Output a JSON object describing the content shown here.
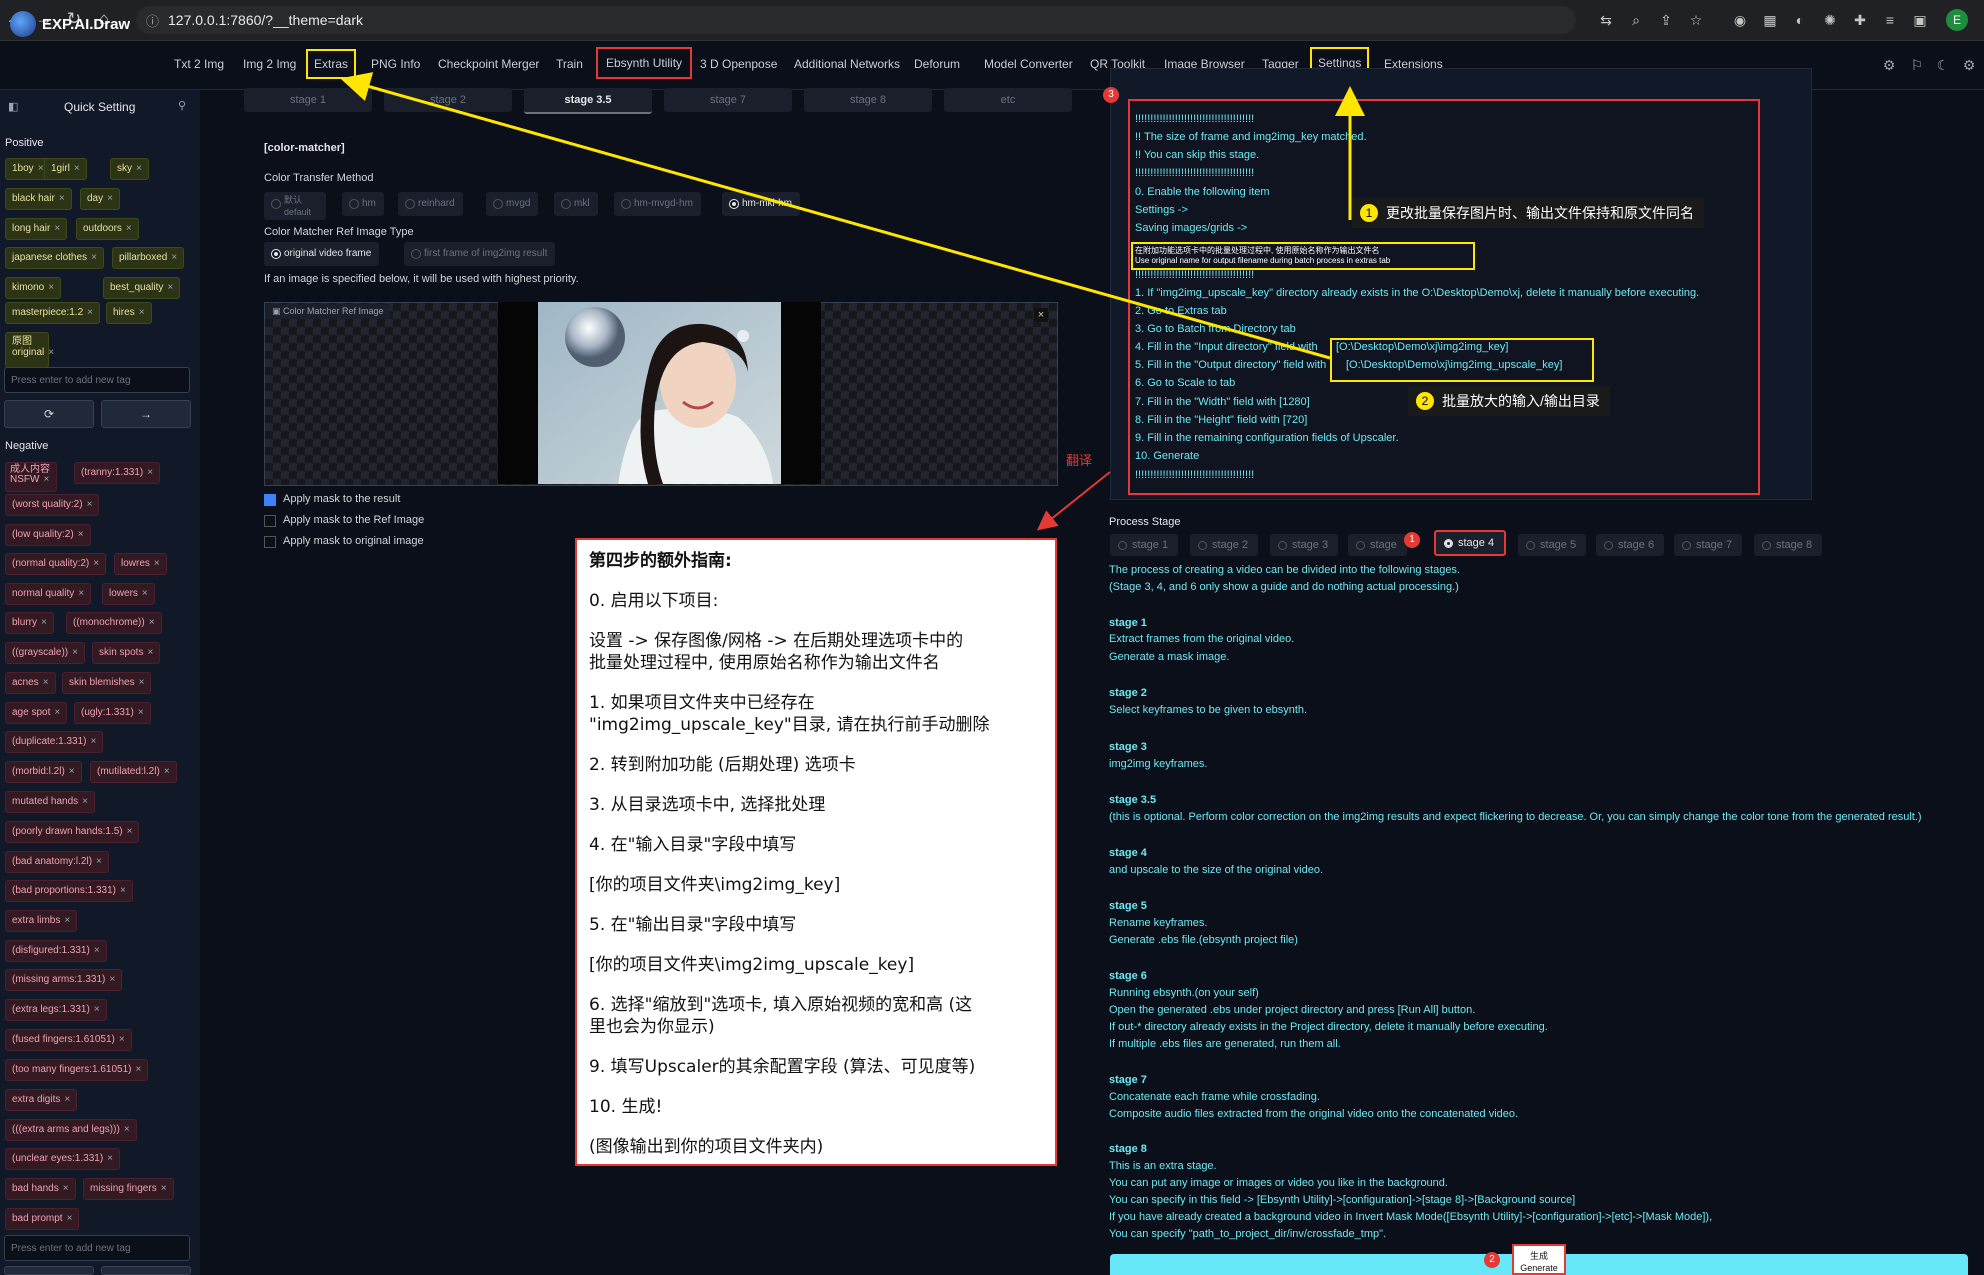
{
  "browser": {
    "url": "127.0.0.1:7860/?__theme=dark",
    "profile_initial": "E"
  },
  "app": {
    "name": "EXP.AI.Draw",
    "tabs": [
      "Txt 2 Img",
      "Img 2 Img",
      "Extras",
      "PNG Info",
      "Checkpoint Merger",
      "Train",
      "Ebsynth Utility",
      "3 D Openpose",
      "Additional Networks",
      "Deforum",
      "Model Converter",
      "QR Toolkit",
      "Image Browser",
      "Tagger",
      "Settings",
      "Extensions"
    ]
  },
  "left": {
    "title": "Quick Setting",
    "positive_label": "Positive",
    "positive_tags": [
      "1boy",
      "1girl",
      "sky",
      "black hair",
      "day",
      "long hair",
      "outdoors",
      "japanese clothes",
      "pillarboxed",
      "kimono",
      "best_quality",
      "masterpiece:1.2",
      "hires",
      "原图 original"
    ],
    "tag_placeholder": "Press enter to add new tag",
    "negative_label": "Negative",
    "negative_tags": [
      "成人内容 NSFW",
      "(tranny:1.331)",
      "(worst quality:2)",
      "(low quality:2)",
      "(normal quality:2)",
      "lowres",
      "normal quality",
      "lowers",
      "blurry",
      "((monochrome))",
      "((grayscale))",
      "skin spots",
      "acnes",
      "skin blemishes",
      "age spot",
      "(ugly:1.331)",
      "(duplicate:1.331)",
      "(morbid:l.2l)",
      "(mutilated:l.2l)",
      "mutated hands",
      "(poorly drawn hands:1.5)",
      "(bad anatomy:l.2l)",
      "(bad proportions:1.331)",
      "extra limbs",
      "(disfigured:1.331)",
      "(missing arms:1.331)",
      "(extra legs:1.331)",
      "(fused fingers:1.61051)",
      "(too many fingers:1.61051)",
      "extra digits",
      "(((extra arms and legs)))",
      "(unclear eyes:1.331)",
      "bad hands",
      "missing fingers",
      "bad prompt"
    ]
  },
  "mid": {
    "stage_tabs": [
      "stage 1",
      "stage 2",
      "stage 3.5",
      "stage 7",
      "stage 8",
      "etc"
    ],
    "section_title": "[color-matcher]",
    "transfer_label": "Color Transfer Method",
    "transfer_options": [
      "默认 default",
      "hm",
      "reinhard",
      "mvgd",
      "mkl",
      "hm-mvgd-hm",
      "hm-mkl-hm"
    ],
    "ref_type_label": "Color Matcher Ref Image Type",
    "ref_type_options": [
      "original video frame",
      "first frame of img2img result"
    ],
    "priority_note": "If an image is specified below, it will be used with highest priority.",
    "image_label": "Color Matcher Ref Image",
    "checkboxes": [
      "Apply mask to the result",
      "Apply mask to the Ref Image",
      "Apply mask to original image"
    ],
    "translate_label": "翻译"
  },
  "guide": {
    "title": "第四步的额外指南:",
    "lines": [
      "0. 启用以下项目:",
      "设置 -> 保存图像/网格 -> 在后期处理选项卡中的",
      "批量处理过程中, 使用原始名称作为输出文件名",
      "1. 如果项目文件夹中已经存在",
      "\"img2img_upscale_key\"目录, 请在执行前手动删除",
      "2. 转到附加功能 (后期处理) 选项卡",
      "3. 从目录选项卡中, 选择批处理",
      "4. 在\"输入目录\"字段中填写",
      "[你的项目文件夹\\img2img_key]",
      "5. 在\"输出目录\"字段中填写",
      "[你的项目文件夹\\img2img_upscale_key]",
      "6. 选择\"缩放到\"选项卡, 填入原始视频的宽和高 (这",
      "里也会为你显示)",
      "9. 填写Upscaler的其余配置字段 (算法、可见度等)",
      "10. 生成!",
      "(图像输出到你的项目文件夹内)"
    ]
  },
  "log": {
    "badge": "3",
    "lines": [
      "!!!!!!!!!!!!!!!!!!!!!!!!!!!!!!!!!!!!!!!",
      "!! The size of frame and img2img_key matched.",
      "!! You can skip this stage.",
      "!!!!!!!!!!!!!!!!!!!!!!!!!!!!!!!!!!!!!!!",
      "0. Enable the following item",
      "Settings ->",
      "Saving images/grids ->",
      "在附加功能选项卡中的批量处理过程中, 使用原始名称作为输出文件名",
      "Use original name for output filename during batch process in extras tab",
      "!!!!!!!!!!!!!!!!!!!!!!!!!!!!!!!!!!!!!!!",
      "1. If \"img2img_upscale_key\" directory already exists in the O:\\Desktop\\Demo\\xj, delete it manually before executing.",
      "2. Go to Extras tab",
      "3. Go to Batch from Directory tab",
      "4. Fill in the \"Input directory\" field with",
      "[O:\\Desktop\\Demo\\xj\\img2img_key]",
      "5. Fill in the \"Output directory\" field with",
      "[O:\\Desktop\\Demo\\xj\\img2img_upscale_key]",
      "6. Go to Scale to tab",
      "7. Fill in the \"Width\" field with [1280]",
      "8. Fill in the \"Height\" field with [720]",
      "9. Fill in the remaining configuration fields of Upscaler.",
      "10. Generate",
      "!!!!!!!!!!!!!!!!!!!!!!!!!!!!!!!!!!!!!!!"
    ]
  },
  "callouts": [
    {
      "num": "1",
      "text": "更改批量保存图片时、输出文件保持和原文件同名"
    },
    {
      "num": "2",
      "text": "批量放大的输入/输出目录"
    }
  ],
  "process": {
    "label": "Process Stage",
    "stages": [
      "stage 1",
      "stage 2",
      "stage 3",
      "stage",
      "stage 4",
      "stage 5",
      "stage 6",
      "stage 7",
      "stage 8"
    ],
    "badge1": "1",
    "badge2": "2",
    "generate": "生成 Generate",
    "desc": [
      {
        "t": "The process of creating a video can be divided into the following stages.",
        "b": false
      },
      {
        "t": "(Stage 3, 4, and 6 only show a guide and do nothing actual processing.)",
        "b": false
      },
      {
        "t": "stage 1",
        "b": true
      },
      {
        "t": "Extract frames from the original video.",
        "b": false
      },
      {
        "t": "Generate a mask image.",
        "b": false
      },
      {
        "t": "stage 2",
        "b": true
      },
      {
        "t": "Select keyframes to be given to ebsynth.",
        "b": false
      },
      {
        "t": "stage 3",
        "b": true
      },
      {
        "t": "img2img keyframes.",
        "b": false
      },
      {
        "t": "stage 3.5",
        "b": true
      },
      {
        "t": "(this is optional. Perform color correction on the img2img results and expect flickering to decrease. Or, you can simply change the color tone from the generated result.)",
        "b": false
      },
      {
        "t": "stage 4",
        "b": true
      },
      {
        "t": "and upscale to the size of the original video.",
        "b": false
      },
      {
        "t": "stage 5",
        "b": true
      },
      {
        "t": "Rename keyframes.",
        "b": false
      },
      {
        "t": "Generate .ebs file.(ebsynth project file)",
        "b": false
      },
      {
        "t": "stage 6",
        "b": true
      },
      {
        "t": "Running ebsynth.(on your self)",
        "b": false
      },
      {
        "t": "Open the generated .ebs under project directory and press [Run All] button.",
        "b": false
      },
      {
        "t": "If out-* directory already exists in the Project directory, delete it manually before executing.",
        "b": false
      },
      {
        "t": "If multiple .ebs files are generated, run them all.",
        "b": false
      },
      {
        "t": "stage 7",
        "b": true
      },
      {
        "t": "Concatenate each frame while crossfading.",
        "b": false
      },
      {
        "t": "Composite audio files extracted from the original video onto the concatenated video.",
        "b": false
      },
      {
        "t": "stage 8",
        "b": true
      },
      {
        "t": "This is an extra stage.",
        "b": false
      },
      {
        "t": "You can put any image or images or video you like in the background.",
        "b": false
      },
      {
        "t": "You can specify in this field -> [Ebsynth Utility]->[configuration]->[stage 8]->[Background source]",
        "b": false
      },
      {
        "t": "If you have already created a background video in Invert Mask Mode([Ebsynth Utility]->[configuration]->[etc]->[Mask Mode]),",
        "b": false
      },
      {
        "t": "You can specify \"path_to_project_dir/inv/crossfade_tmp\".",
        "b": false
      }
    ]
  },
  "colors": {
    "highlight_yellow": "#ffe600",
    "highlight_red": "#e53935",
    "text_cyan": "#6ee7f0",
    "bg": "#0b0f19"
  }
}
